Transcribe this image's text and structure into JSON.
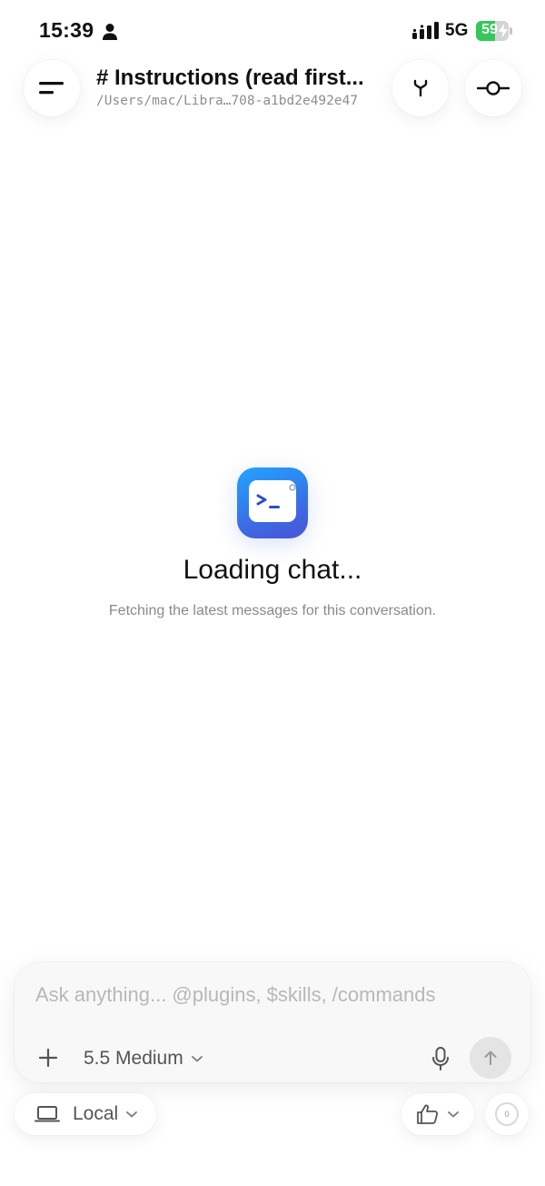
{
  "status_bar": {
    "time": "15:39",
    "network": "5G",
    "battery_level": "59",
    "battery_fraction": 0.59,
    "icons": [
      "person-icon",
      "signal-icon",
      "battery-icon",
      "charging-bolt-icon"
    ]
  },
  "header": {
    "title": "# Instructions (read first...",
    "path": "/Users/mac/Libra…708-a1bd2e492e47",
    "icons": [
      "menu-icon",
      "branch-icon",
      "commit-icon"
    ]
  },
  "loading": {
    "title": "Loading chat...",
    "subtitle": "Fetching the latest messages for this conversation.",
    "icon": "terminal-app-icon"
  },
  "composer": {
    "placeholder": "Ask anything... @plugins, $skills, /commands",
    "model": "5.5 Medium",
    "icons": [
      "plus-icon",
      "chevron-down-icon",
      "microphone-icon",
      "arrow-up-icon"
    ]
  },
  "footer": {
    "environment": "Local",
    "context_usage": "0",
    "icons": [
      "laptop-icon",
      "chevron-down-icon",
      "thumbs-up-icon",
      "context-ring-icon"
    ]
  },
  "colors": {
    "accent_green": "#34c759",
    "app_icon_top": "#21a5ff",
    "app_icon_bottom": "#4a52d6",
    "muted_text": "#8a8a8a",
    "placeholder_text": "#b8b8b8"
  }
}
